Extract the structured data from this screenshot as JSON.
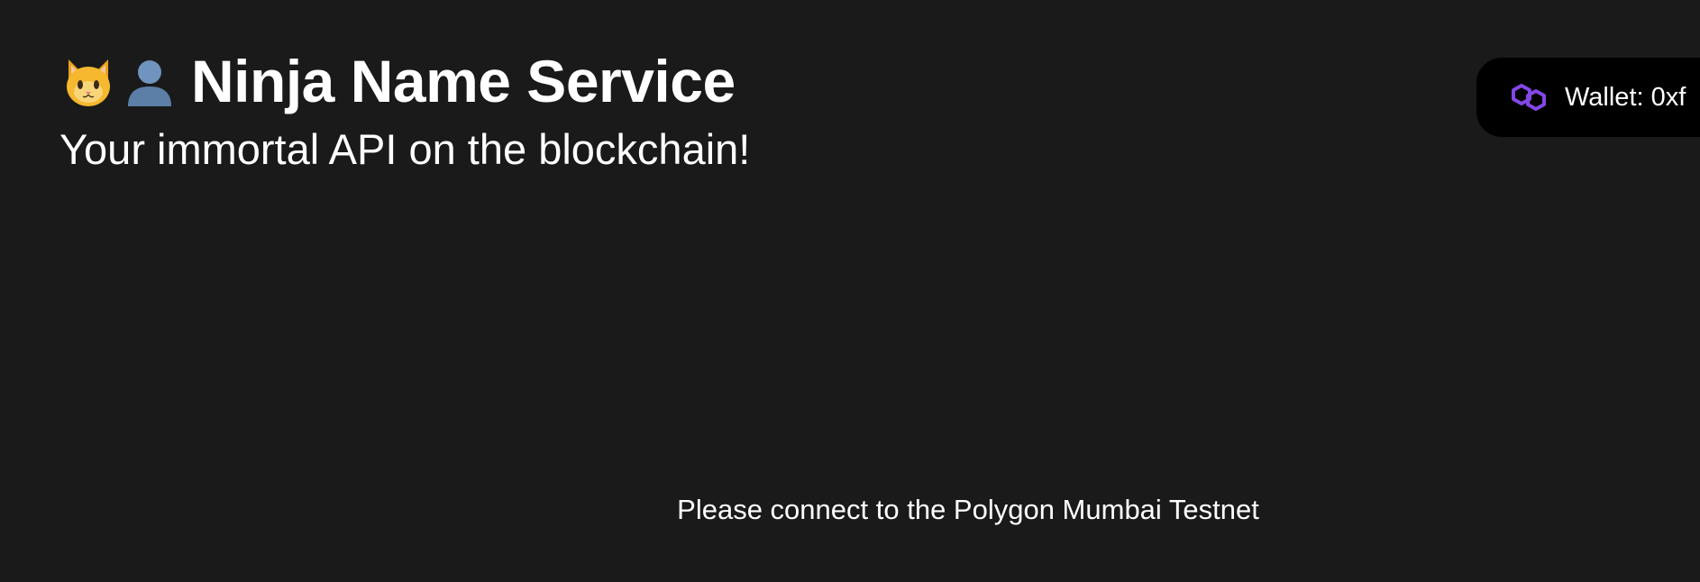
{
  "header": {
    "title": "Ninja Name Service",
    "subtitle": "Your immortal API on the blockchain!",
    "emoji_icons": [
      "cat-face-icon",
      "person-silhouette-icon"
    ]
  },
  "wallet": {
    "label": "Wallet: 0xf",
    "icon": "polygon-icon",
    "icon_color": "#8247e5"
  },
  "main": {
    "message": "Please connect to the Polygon Mumbai Testnet"
  },
  "colors": {
    "background": "#1a1a1a",
    "pill": "#000000",
    "text": "#ffffff"
  }
}
